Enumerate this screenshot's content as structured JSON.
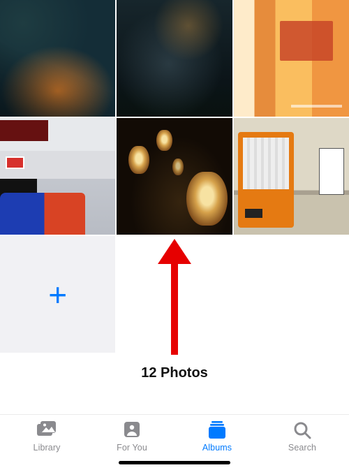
{
  "grid": {
    "photos": [
      {
        "name": "photo-1",
        "palette": "teal-orange-industrial"
      },
      {
        "name": "photo-2",
        "palette": "dark-blue-instruments"
      },
      {
        "name": "photo-3",
        "palette": "warm-alley-illustration"
      },
      {
        "name": "photo-4",
        "palette": "tokyo-street-photo"
      },
      {
        "name": "photo-5",
        "palette": "dark-lanterns"
      },
      {
        "name": "photo-6",
        "palette": "vending-machine-wall"
      }
    ],
    "add_glyph": "+"
  },
  "counter": {
    "text": "12 Photos"
  },
  "tabs": {
    "library": "Library",
    "for_you": "For You",
    "albums": "Albums",
    "search": "Search",
    "active": "albums"
  },
  "annotation": {
    "type": "up-arrow",
    "color": "#e60000"
  }
}
